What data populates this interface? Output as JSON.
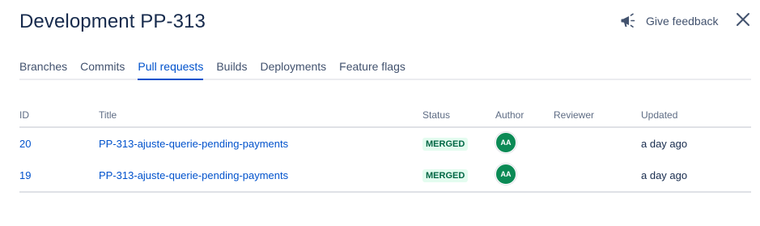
{
  "header": {
    "title": "Development PP-313",
    "feedback_label": "Give feedback",
    "feedback_icon": "megaphone-icon",
    "close_icon": "close-icon"
  },
  "tabs": [
    {
      "label": "Branches",
      "active": false
    },
    {
      "label": "Commits",
      "active": false
    },
    {
      "label": "Pull requests",
      "active": true
    },
    {
      "label": "Builds",
      "active": false
    },
    {
      "label": "Deployments",
      "active": false
    },
    {
      "label": "Feature flags",
      "active": false
    }
  ],
  "table": {
    "columns": {
      "id": "ID",
      "title": "Title",
      "status": "Status",
      "author": "Author",
      "reviewer": "Reviewer",
      "updated": "Updated"
    },
    "rows": [
      {
        "id": "20",
        "title": "PP-313-ajuste-querie-pending-payments",
        "status": "MERGED",
        "author": "AA",
        "reviewer": "",
        "updated": "a day ago"
      },
      {
        "id": "19",
        "title": "PP-313-ajuste-querie-pending-payments",
        "status": "MERGED",
        "author": "AA",
        "reviewer": "",
        "updated": "a day ago"
      }
    ]
  },
  "colors": {
    "accent": "#0052cc",
    "merged_bg": "#e3fcef",
    "merged_text": "#006644",
    "avatar_bg": "#0b8a55"
  }
}
